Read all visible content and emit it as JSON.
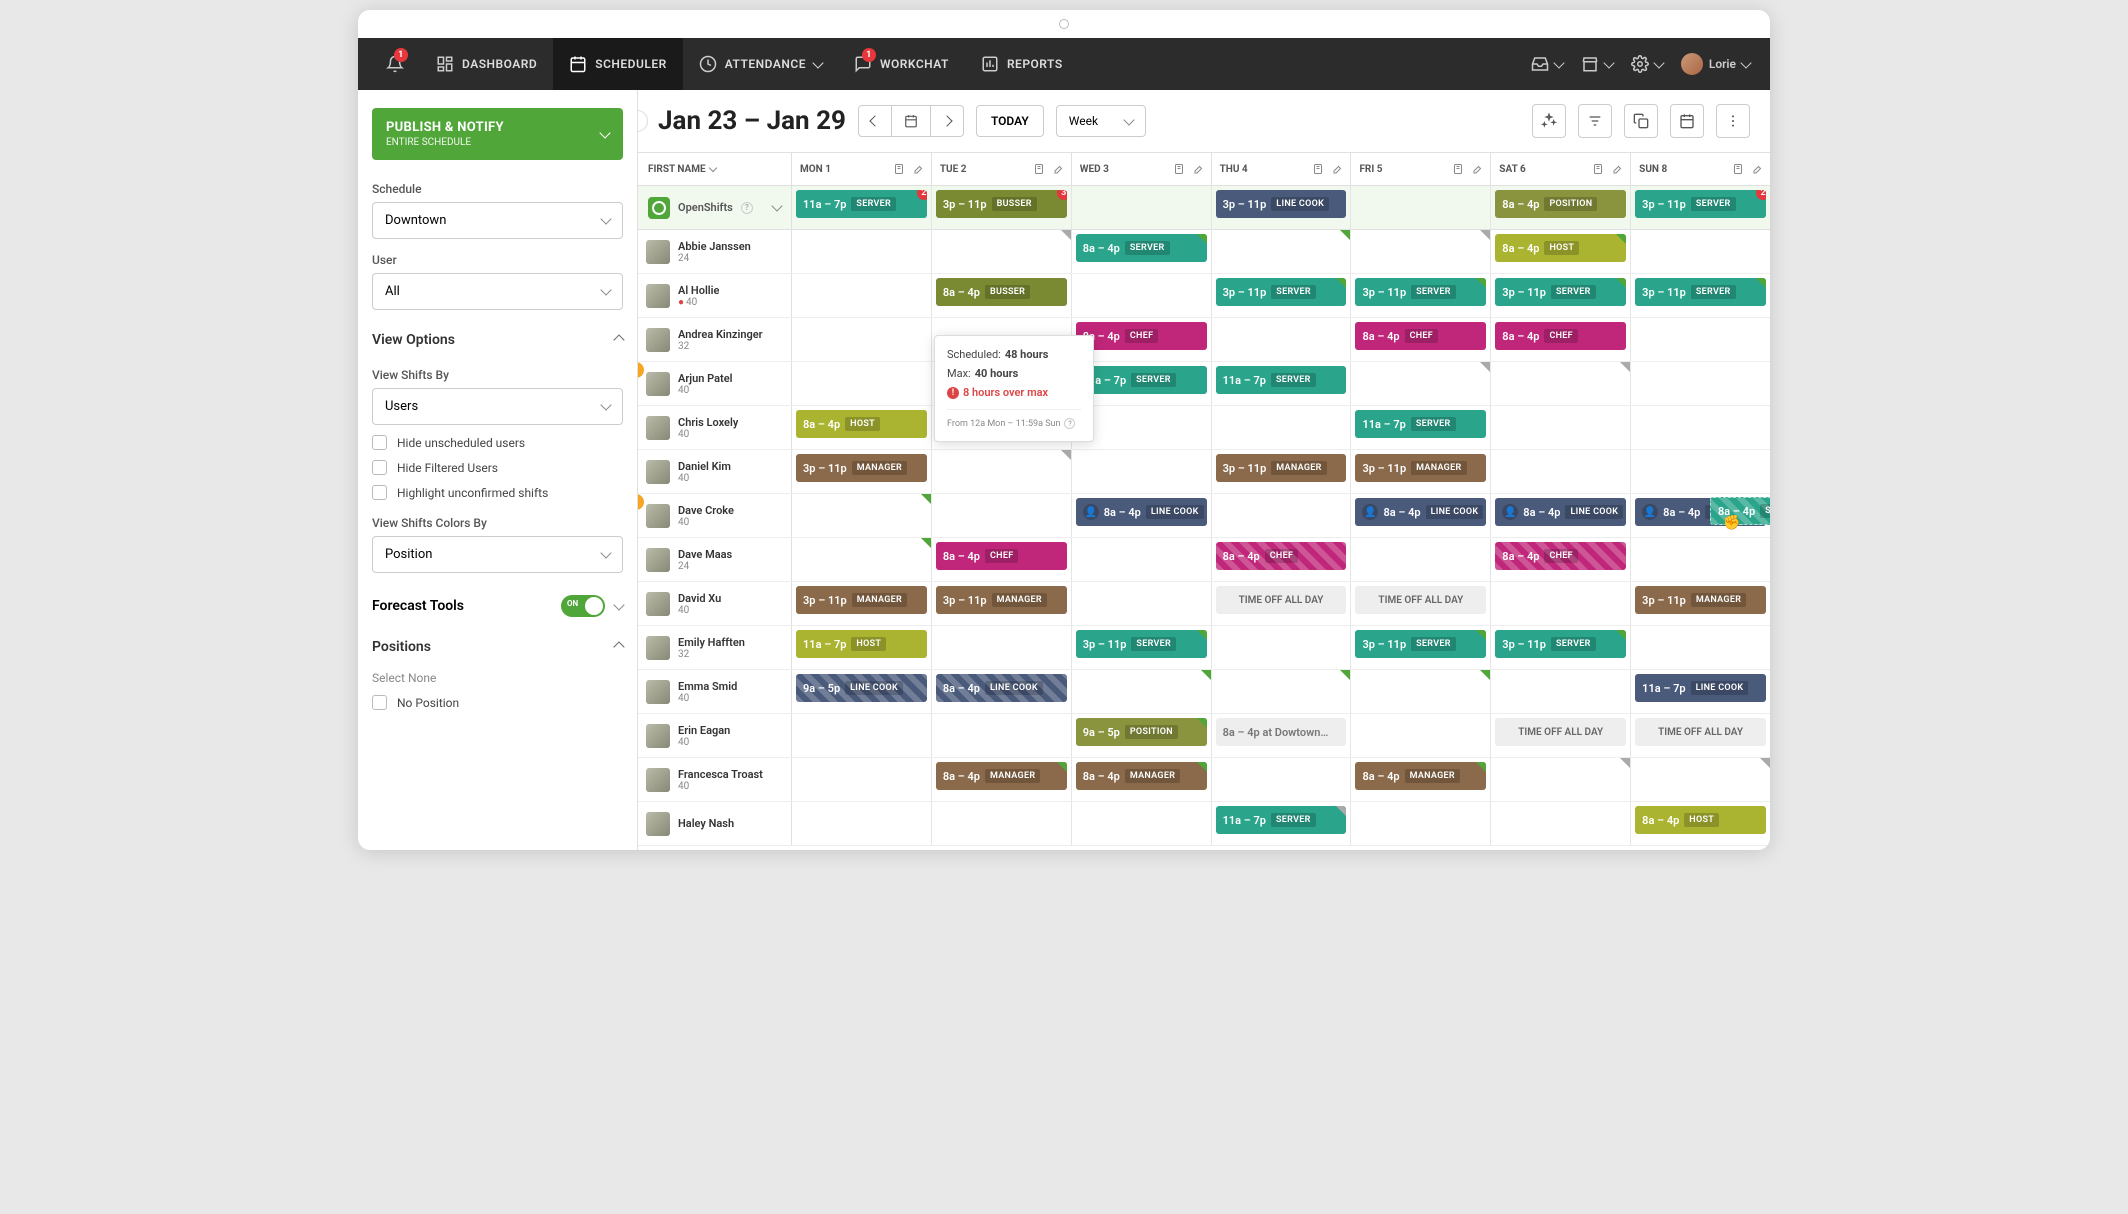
{
  "nav": {
    "dashboard": "DASHBOARD",
    "scheduler": "SCHEDULER",
    "attendance": "ATTENDANCE",
    "workchat": "WORKCHAT",
    "reports": "REPORTS",
    "username": "Lorie",
    "notif_badge": "1",
    "workchat_badge": "1"
  },
  "toolbar": {
    "date_range": "Jan 23 – Jan 29",
    "today": "TODAY",
    "view": "Week"
  },
  "publish": {
    "title": "PUBLISH & NOTIFY",
    "sub": "ENTIRE SCHEDULE"
  },
  "sidebar": {
    "schedule_label": "Schedule",
    "schedule_value": "Downtown",
    "user_label": "User",
    "user_value": "All",
    "view_options": "View Options",
    "view_shifts_by_label": "View Shifts By",
    "view_shifts_by_value": "Users",
    "hide_unscheduled": "Hide unscheduled users",
    "hide_filtered": "Hide Filtered Users",
    "highlight_unconfirmed": "Highlight unconfirmed shifts",
    "colors_by_label": "View Shifts Colors By",
    "colors_by_value": "Position",
    "forecast": "Forecast Tools",
    "toggle_on": "ON",
    "positions": "Positions",
    "select_none": "Select None",
    "no_position": "No Position"
  },
  "grid": {
    "name_header": "FIRST NAME",
    "days": [
      "MON 1",
      "TUE 2",
      "WED 3",
      "THU 4",
      "FRI 5",
      "SAT 6",
      "SUN 8"
    ],
    "openshifts_label": "OpenShifts",
    "openshifts": [
      {
        "time": "11a – 7p",
        "pos": "SERVER",
        "cls": "c-server",
        "badge": "2"
      },
      {
        "time": "3p – 11p",
        "pos": "BUSSER",
        "cls": "c-busser",
        "badge": "3"
      },
      null,
      {
        "time": "3p – 11p",
        "pos": "LINE COOK",
        "cls": "c-linecook"
      },
      null,
      {
        "time": "8a – 4p",
        "pos": "POSITION",
        "cls": "c-position"
      },
      {
        "time": "3p – 11p",
        "pos": "SERVER",
        "cls": "c-server",
        "badge": "2"
      }
    ],
    "users": [
      {
        "name": "Abbie Janssen",
        "hours": "24",
        "shifts": [
          null,
          null,
          {
            "time": "8a – 4p",
            "pos": "SERVER",
            "cls": "c-server",
            "corner": "green"
          },
          null,
          null,
          {
            "time": "8a – 4p",
            "pos": "HOST",
            "cls": "c-host",
            "corner": "green"
          },
          null
        ],
        "corners": [
          null,
          "gray",
          null,
          "green",
          "gray",
          null,
          null
        ]
      },
      {
        "name": "Al Hollie",
        "hours": "40",
        "alert": true,
        "shifts": [
          null,
          {
            "time": "8a – 4p",
            "pos": "BUSSER",
            "cls": "c-busser"
          },
          null,
          {
            "time": "3p – 11p",
            "pos": "SERVER",
            "cls": "c-server",
            "corner": "green"
          },
          {
            "time": "3p – 11p",
            "pos": "SERVER",
            "cls": "c-server",
            "corner": "green"
          },
          {
            "time": "3p – 11p",
            "pos": "SERVER",
            "cls": "c-server",
            "corner": "green"
          },
          {
            "time": "3p – 11p",
            "pos": "SERVER",
            "cls": "c-server",
            "corner": "green"
          }
        ]
      },
      {
        "name": "Andrea Kinzinger",
        "hours": "32",
        "shifts": [
          null,
          null,
          {
            "time": "8a – 4p",
            "pos": "CHEF",
            "cls": "c-chef"
          },
          null,
          {
            "time": "8a – 4p",
            "pos": "CHEF",
            "cls": "c-chef"
          },
          {
            "time": "8a – 4p",
            "pos": "CHEF",
            "cls": "c-chef"
          },
          null
        ]
      },
      {
        "name": "Arjun Patel",
        "hours": "40",
        "warn": true,
        "shifts": [
          null,
          {
            "time": "11a – 7p",
            "pos": "SERVER",
            "cls": "c-server"
          },
          {
            "time": "11a – 7p",
            "pos": "SERVER",
            "cls": "c-server"
          },
          {
            "time": "11a – 7p",
            "pos": "SERVER",
            "cls": "c-server"
          },
          null,
          null,
          null
        ],
        "corners": [
          null,
          null,
          null,
          null,
          "gray",
          "gray",
          null
        ]
      },
      {
        "name": "Chris Loxely",
        "hours": "40",
        "shifts": [
          {
            "time": "8a – 4p",
            "pos": "HOST",
            "cls": "c-host"
          },
          {
            "time": "8a – 4p",
            "pos": "HOST",
            "cls": "c-host"
          },
          null,
          null,
          {
            "time": "11a – 7p",
            "pos": "SERVER",
            "cls": "c-server"
          },
          null,
          null
        ]
      },
      {
        "name": "Daniel Kim",
        "hours": "40",
        "shifts": [
          {
            "time": "3p – 11p",
            "pos": "MANAGER",
            "cls": "c-manager"
          },
          null,
          null,
          {
            "time": "3p – 11p",
            "pos": "MANAGER",
            "cls": "c-manager"
          },
          {
            "time": "3p – 11p",
            "pos": "MANAGER",
            "cls": "c-manager"
          },
          null,
          null
        ],
        "corners": [
          null,
          "gray",
          null,
          null,
          null,
          null,
          null
        ]
      },
      {
        "name": "Dave Croke",
        "hours": "40",
        "warn": true,
        "shifts": [
          null,
          null,
          {
            "time": "8a – 4p",
            "pos": "LINE COOK",
            "cls": "c-linecook",
            "person": true
          },
          null,
          {
            "time": "8a – 4p",
            "pos": "LINE COOK",
            "cls": "c-linecook",
            "person": true
          },
          {
            "time": "8a – 4p",
            "pos": "LINE COOK",
            "cls": "c-linecook",
            "person": true
          },
          {
            "time": "8a – 4p",
            "pos": "LINE COOK",
            "cls": "c-linecook",
            "person": true
          }
        ],
        "corners": [
          "green",
          null,
          null,
          null,
          null,
          null,
          null
        ]
      },
      {
        "name": "Dave Maas",
        "hours": "24",
        "shifts": [
          null,
          {
            "time": "8a – 4p",
            "pos": "CHEF",
            "cls": "c-chef"
          },
          null,
          {
            "time": "8a – 4p",
            "pos": "CHEF",
            "cls": "c-chef",
            "striped": true
          },
          null,
          {
            "time": "8a – 4p",
            "pos": "CHEF",
            "cls": "c-chef",
            "striped": true
          },
          null
        ],
        "corners": [
          "green",
          null,
          null,
          null,
          null,
          null,
          null
        ]
      },
      {
        "name": "David Xu",
        "hours": "40",
        "shifts": [
          {
            "time": "3p – 11p",
            "pos": "MANAGER",
            "cls": "c-manager"
          },
          {
            "time": "3p – 11p",
            "pos": "MANAGER",
            "cls": "c-manager"
          },
          null,
          {
            "timeoff": "TIME OFF ALL DAY"
          },
          {
            "timeoff": "TIME OFF ALL DAY"
          },
          null,
          {
            "time": "3p – 11p",
            "pos": "MANAGER",
            "cls": "c-manager"
          }
        ]
      },
      {
        "name": "Emily Hafften",
        "hours": "32",
        "shifts": [
          {
            "time": "11a – 7p",
            "pos": "HOST",
            "cls": "c-host"
          },
          null,
          {
            "time": "3p – 11p",
            "pos": "SERVER",
            "cls": "c-server",
            "corner": "green"
          },
          null,
          {
            "time": "3p – 11p",
            "pos": "SERVER",
            "cls": "c-server",
            "corner": "green"
          },
          {
            "time": "3p – 11p",
            "pos": "SERVER",
            "cls": "c-server",
            "corner": "green"
          },
          null
        ]
      },
      {
        "name": "Emma Smid",
        "hours": "40",
        "shifts": [
          {
            "time": "9a – 5p",
            "pos": "LINE COOK",
            "cls": "c-linecook",
            "striped": true
          },
          {
            "time": "8a – 4p",
            "pos": "LINE COOK",
            "cls": "c-linecook",
            "striped": true
          },
          null,
          null,
          null,
          null,
          {
            "time": "11a – 7p",
            "pos": "LINE COOK",
            "cls": "c-linecook"
          }
        ],
        "corners": [
          null,
          null,
          "green",
          "green",
          "green",
          null,
          null
        ]
      },
      {
        "name": "Erin Eagan",
        "hours": "40",
        "shifts": [
          null,
          null,
          {
            "time": "9a – 5p",
            "pos": "POSITION",
            "cls": "c-position",
            "corner": "green"
          },
          {
            "text": "8a – 4p at Dowtown…",
            "cls": "c-gray"
          },
          null,
          {
            "timeoff": "TIME OFF ALL DAY"
          },
          {
            "timeoff": "TIME OFF ALL DAY"
          }
        ]
      },
      {
        "name": "Francesca Troast",
        "hours": "40",
        "shifts": [
          null,
          {
            "time": "8a – 4p",
            "pos": "MANAGER",
            "cls": "c-manager",
            "corner": "green"
          },
          {
            "time": "8a – 4p",
            "pos": "MANAGER",
            "cls": "c-manager",
            "corner": "green"
          },
          null,
          {
            "time": "8a – 4p",
            "pos": "MANAGER",
            "cls": "c-manager",
            "corner": "green"
          },
          null,
          null
        ],
        "corners": [
          null,
          null,
          null,
          null,
          null,
          "gray",
          "gray"
        ]
      },
      {
        "name": "Haley Nash",
        "hours": "",
        "shifts": [
          null,
          null,
          null,
          {
            "time": "11a – 7p",
            "pos": "SERVER",
            "cls": "c-server",
            "corner": "gray"
          },
          null,
          null,
          {
            "time": "8a – 4p",
            "pos": "HOST",
            "cls": "c-host"
          }
        ]
      }
    ]
  },
  "tooltip": {
    "scheduled_label": "Scheduled:",
    "scheduled_value": "48 hours",
    "max_label": "Max:",
    "max_value": "40 hours",
    "error": "8 hours over max",
    "footer": "From 12a Mon – 11:59a Sun"
  },
  "drag": {
    "time": "8a – 4p",
    "pos": "SERVER"
  }
}
